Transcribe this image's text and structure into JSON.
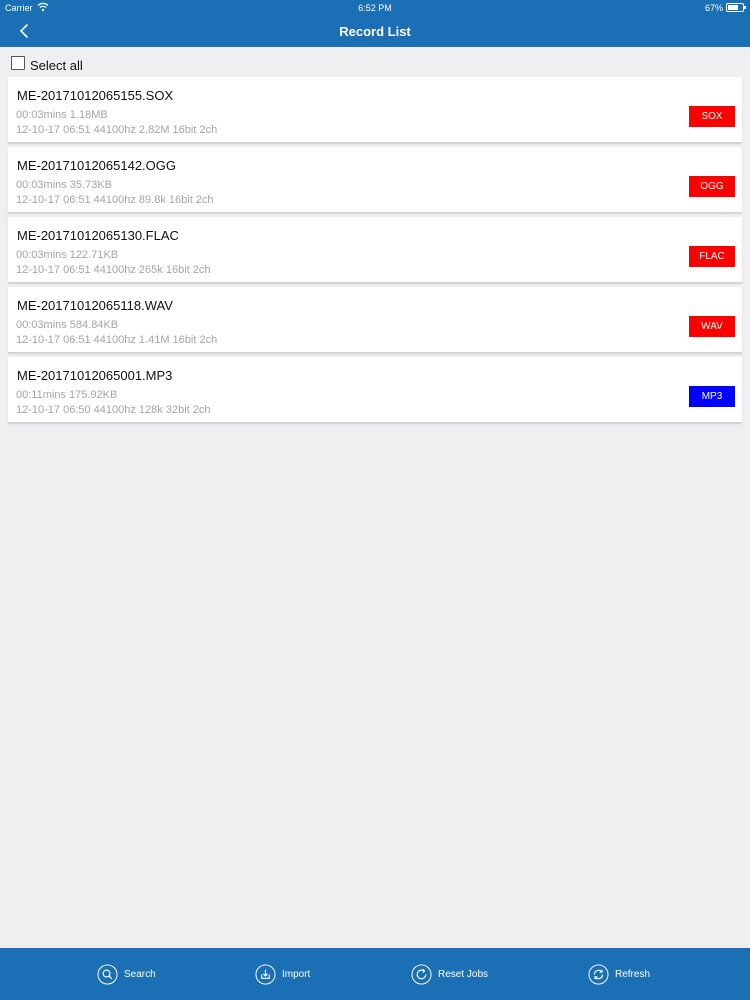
{
  "status": {
    "carrier": "Carrier",
    "time": "6:52 PM",
    "battery": "67%"
  },
  "nav": {
    "title": "Record List"
  },
  "select_all": {
    "label": "Select all"
  },
  "records": [
    {
      "name": "ME-20171012065155.SOX",
      "duration_size": "00:03mins  1.18MB",
      "details": "12-10-17 06:51 44100hz 2.82M 16bit 2ch",
      "format": "SOX",
      "color": "#ff0000"
    },
    {
      "name": "ME-20171012065142.OGG",
      "duration_size": "00:03mins  35.73KB",
      "details": "12-10-17 06:51 44100hz 89.8k 16bit 2ch",
      "format": "OGG",
      "color": "#ff0000"
    },
    {
      "name": "ME-20171012065130.FLAC",
      "duration_size": "00:03mins  122.71KB",
      "details": "12-10-17 06:51 44100hz 265k 16bit 2ch",
      "format": "FLAC",
      "color": "#ff0000"
    },
    {
      "name": "ME-20171012065118.WAV",
      "duration_size": "00:03mins  584.84KB",
      "details": "12-10-17 06:51 44100hz 1.41M 16bit 2ch",
      "format": "WAV",
      "color": "#ff0000"
    },
    {
      "name": "ME-20171012065001.MP3",
      "duration_size": "00:11mins  175.92KB",
      "details": "12-10-17 06:50 44100hz 128k 32bit 2ch",
      "format": "MP3",
      "color": "#0000ff"
    }
  ],
  "tabbar": {
    "search": "Search",
    "import": "Import",
    "reset_jobs": "Reset Jobs",
    "refresh": "Refresh"
  },
  "colors": {
    "accent": "#1b6fb4",
    "background": "#efeff1"
  }
}
